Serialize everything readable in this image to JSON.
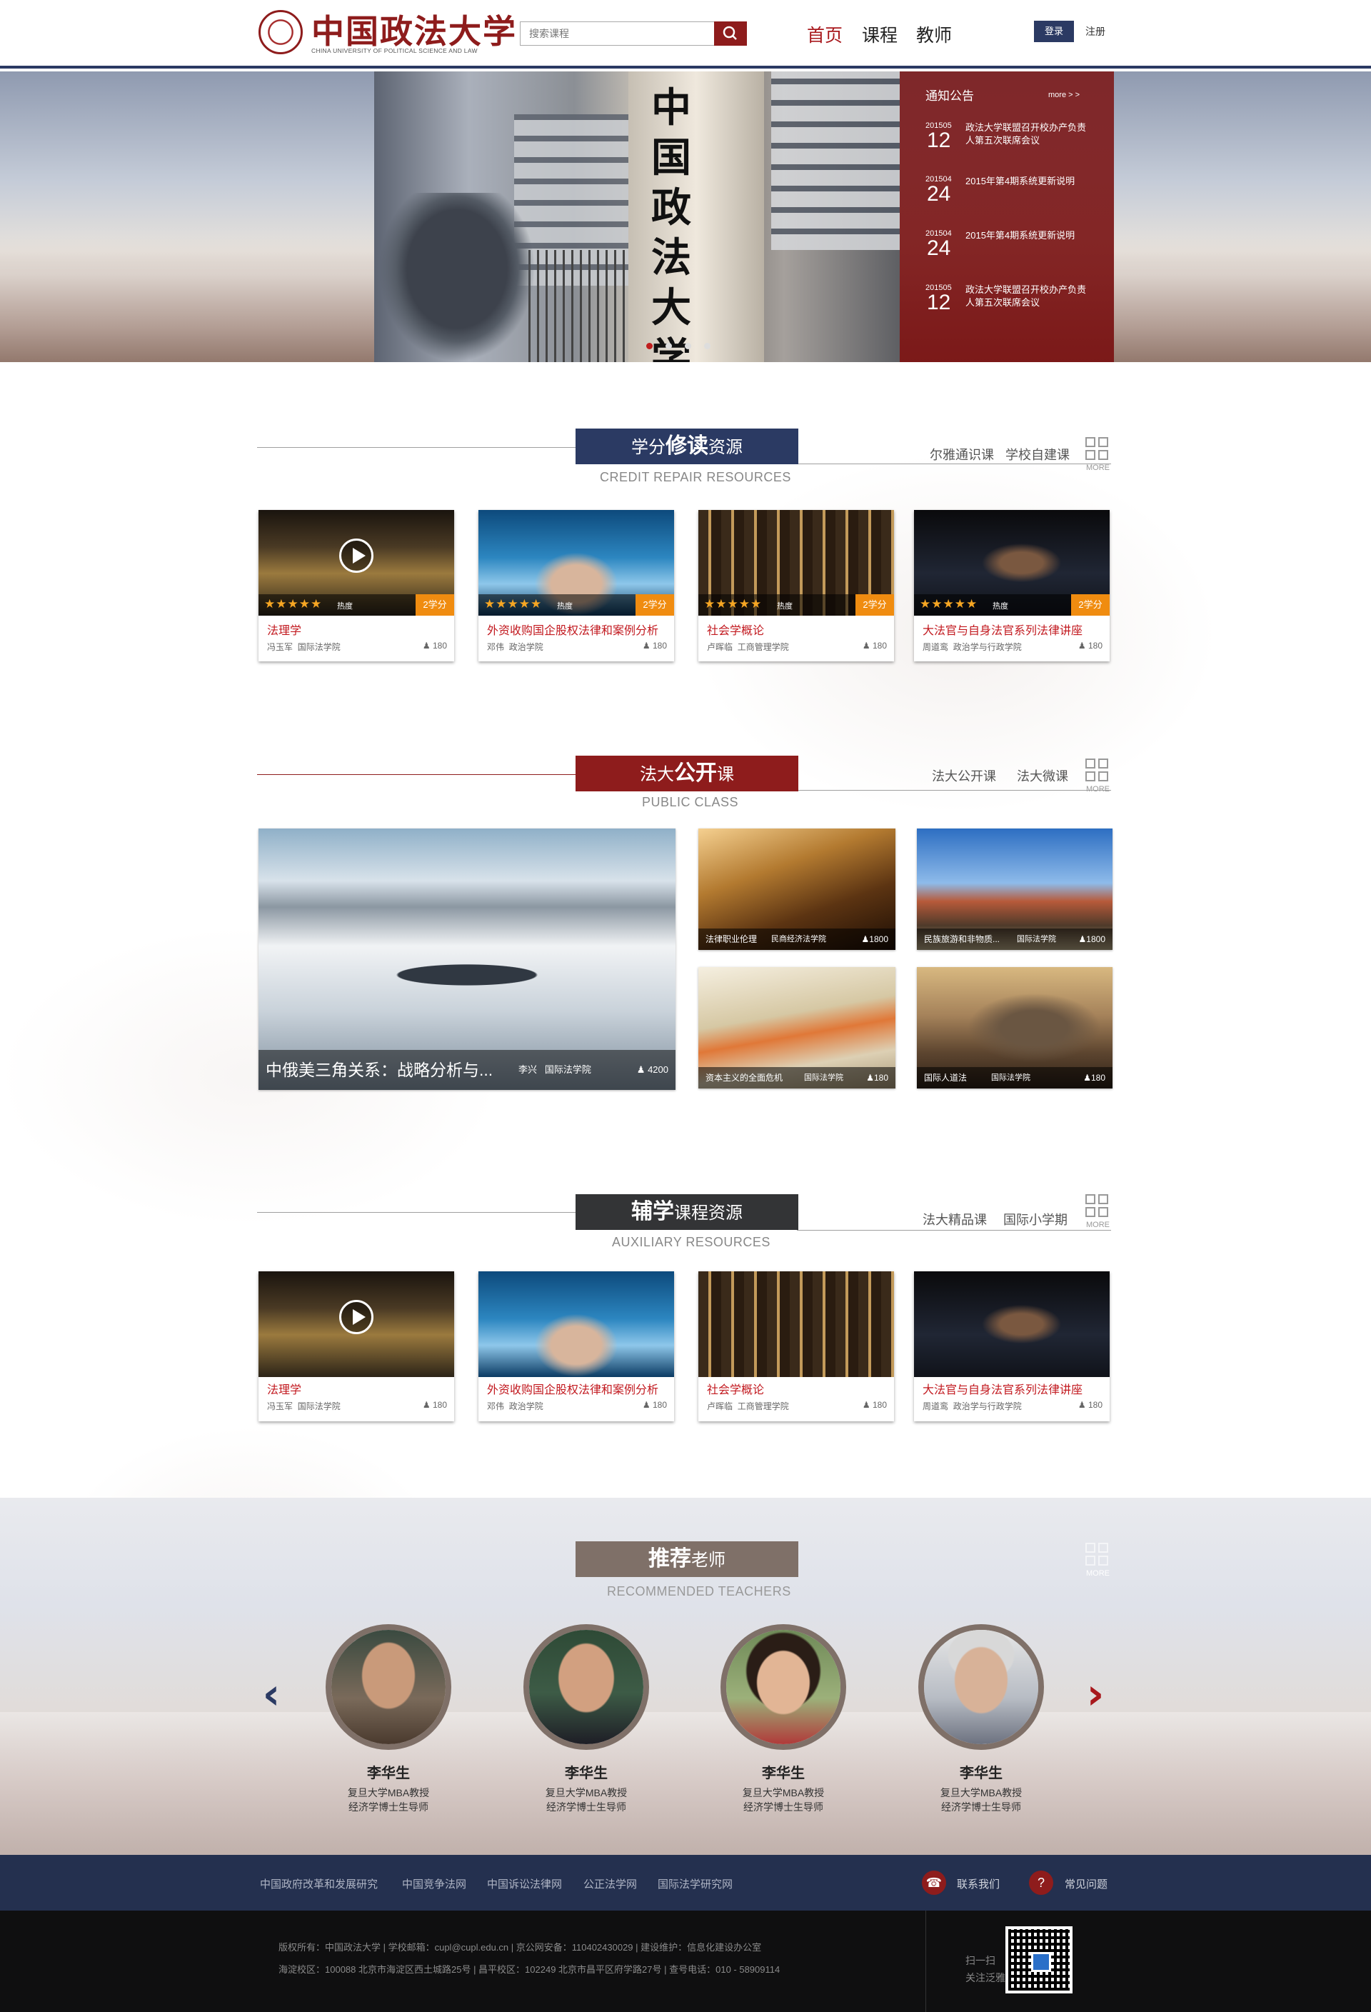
{
  "header": {
    "logo_cn": "中国政法大学",
    "logo_en": "CHINA UNIVERSITY OF POLITICAL SCIENCE AND LAW",
    "search_placeholder": "搜索课程",
    "nav": [
      "首页",
      "课程",
      "教师"
    ],
    "login": "登录",
    "register": "注册"
  },
  "hero": {
    "pillar_text": "中国政法大学"
  },
  "notices": {
    "title": "通知公告",
    "more": "more > >",
    "items": [
      {
        "ym": "201505",
        "day": "12",
        "text": "政法大学联盟召开校办产负责人第五次联席会议"
      },
      {
        "ym": "201504",
        "day": "24",
        "text": "2015年第4期系统更新说明"
      },
      {
        "ym": "201504",
        "day": "24",
        "text": "2015年第4期系统更新说明"
      },
      {
        "ym": "201505",
        "day": "12",
        "text": "政法大学联盟召开校办产负责人第五次联席会议"
      }
    ]
  },
  "credit": {
    "title_pre": "学分",
    "title_bold": "修读",
    "title_post": "资源",
    "subtitle": "CREDIT REPAIR RESOURCES",
    "links": [
      "尔雅通识课",
      "学校自建课"
    ],
    "more": "MORE",
    "cards": [
      {
        "title": "法理学",
        "teacher": "冯玉军",
        "college": "国际法学院",
        "views": "180",
        "stars": "★★★★★",
        "hot": "热度",
        "credit": "2学分"
      },
      {
        "title": "外资收购国企股权法律和案例分析",
        "teacher": "邓伟",
        "college": "政治学院",
        "views": "180",
        "stars": "★★★★★",
        "hot": "热度",
        "credit": "2学分"
      },
      {
        "title": "社会学概论",
        "teacher": "卢晖临",
        "college": "工商管理学院",
        "views": "180",
        "stars": "★★★★★",
        "hot": "热度",
        "credit": "2学分"
      },
      {
        "title": "大法官与自身法官系列法律讲座",
        "teacher": "周道鸾",
        "college": "政治学与行政学院",
        "views": "180",
        "stars": "★★★★★",
        "hot": "热度",
        "credit": "2学分"
      }
    ]
  },
  "public": {
    "title_pre": "法大",
    "title_bold": "公开",
    "title_post": "课",
    "subtitle": "PUBLIC CLASS",
    "links": [
      "法大公开课",
      "法大微课"
    ],
    "more": "MORE",
    "featured": {
      "title": "中俄美三角关系：战略分析与...",
      "teacher": "李兴",
      "college": "国际法学院",
      "views": "4200"
    },
    "tiles": [
      {
        "title": "法律职业伦理",
        "college": "民商经济法学院",
        "views": "1800"
      },
      {
        "title": "民族旅游和非物质...",
        "college": "国际法学院",
        "views": "1800"
      },
      {
        "title": "资本主义的全面危机",
        "college": "国际法学院",
        "views": "180"
      },
      {
        "title": "国际人道法",
        "college": "国际法学院",
        "views": "180"
      }
    ]
  },
  "aux": {
    "title_bold": "辅学",
    "title_post": "课程资源",
    "subtitle": "AUXILIARY  RESOURCES",
    "links": [
      "法大精品课",
      "国际小学期"
    ],
    "more": "MORE",
    "cards": [
      {
        "title": "法理学",
        "teacher": "冯玉军",
        "college": "国际法学院",
        "views": "180"
      },
      {
        "title": "外资收购国企股权法律和案例分析",
        "teacher": "邓伟",
        "college": "政治学院",
        "views": "180"
      },
      {
        "title": "社会学概论",
        "teacher": "卢晖临",
        "college": "工商管理学院",
        "views": "180"
      },
      {
        "title": "大法官与自身法官系列法律讲座",
        "teacher": "周道鸾",
        "college": "政治学与行政学院",
        "views": "180"
      }
    ]
  },
  "teachers": {
    "title_bold": "推荐",
    "title_post": "老师",
    "subtitle": "RECOMMENDED TEACHERS",
    "more": "MORE",
    "list": [
      {
        "name": "李华生",
        "line1": "复旦大学MBA教授",
        "line2": "经济学博士生导师"
      },
      {
        "name": "李华生",
        "line1": "复旦大学MBA教授",
        "line2": "经济学博士生导师"
      },
      {
        "name": "李华生",
        "line1": "复旦大学MBA教授",
        "line2": "经济学博士生导师"
      },
      {
        "name": "李华生",
        "line1": "复旦大学MBA教授",
        "line2": "经济学博士生导师"
      }
    ]
  },
  "footer": {
    "links": [
      "中国政府改革和发展研究",
      "中国竞争法网",
      "中国诉讼法律网",
      "公正法学网",
      "国际法学研究网"
    ],
    "contact": "联系我们",
    "faq": "常见问题",
    "copyright": "版权所有：中国政法大学 | 学校邮箱：cupl@cupl.edu.cn | 京公网安备：110402430029 | 建设维护：信息化建设办公室",
    "address": "海淀校区：100088 北京市海淀区西土城路25号 | 昌平校区：102249 北京市昌平区府学路27号 | 查号电话：010 - 58909114",
    "qr_line1": "扫一扫",
    "qr_line2": "关注泛雅"
  },
  "colors": {
    "brand_red": "#8e1c1c",
    "navy": "#2b3a63",
    "orange": "#f08c10"
  }
}
